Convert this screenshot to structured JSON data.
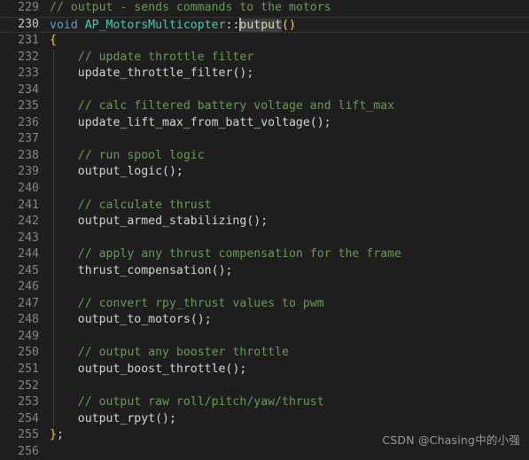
{
  "editor": {
    "theme": "dark-plus",
    "background_color": "#1e1e1e",
    "foreground_color": "#d4d4d4",
    "comment_color": "#6a9955",
    "keyword_color": "#569cd6",
    "type_color": "#4ec9b0",
    "function_color": "#dcdcaa",
    "bracket_color": "#ffd700",
    "gutter_color": "#858585",
    "current_line_number_color": "#c6c6c6",
    "current_line_border_color": "#333333",
    "indent_guide_color": "#404040",
    "word_highlight_color": "#3a3d41",
    "cursor_color": "#aeafad",
    "first_visible_line": 229,
    "last_visible_line": 256,
    "current_line": 230,
    "cursor_line": 230,
    "cursor_column": 31,
    "language": "cpp"
  },
  "watermark": {
    "text": "CSDN @Chasing中的小强"
  },
  "lines": [
    {
      "number": "229",
      "current": false,
      "indent_guide": false,
      "tokens": [
        {
          "t": "// output - sends commands to the motors",
          "c": "cmt"
        }
      ]
    },
    {
      "number": "230",
      "current": true,
      "indent_guide": false,
      "tokens": [
        {
          "t": "void",
          "c": "kw"
        },
        {
          "t": " ",
          "c": "id"
        },
        {
          "t": "AP_MotorsMulticopter",
          "c": "type"
        },
        {
          "t": "::",
          "c": "punc"
        },
        {
          "t": "CARET",
          "c": "caret"
        },
        {
          "t": "output",
          "c": "fn wordhl"
        },
        {
          "t": "(",
          "c": "br1"
        },
        {
          "t": ")",
          "c": "br1"
        }
      ]
    },
    {
      "number": "231",
      "current": false,
      "indent_guide": false,
      "tokens": [
        {
          "t": "{",
          "c": "br1"
        }
      ]
    },
    {
      "number": "232",
      "current": false,
      "indent_guide": true,
      "tokens": [
        {
          "t": "    ",
          "c": "id"
        },
        {
          "t": "// update throttle filter",
          "c": "cmt"
        }
      ]
    },
    {
      "number": "233",
      "current": false,
      "indent_guide": true,
      "tokens": [
        {
          "t": "    ",
          "c": "id"
        },
        {
          "t": "update_throttle_filter",
          "c": "id"
        },
        {
          "t": "();",
          "c": "punc"
        }
      ]
    },
    {
      "number": "234",
      "current": false,
      "indent_guide": true,
      "tokens": []
    },
    {
      "number": "235",
      "current": false,
      "indent_guide": true,
      "tokens": [
        {
          "t": "    ",
          "c": "id"
        },
        {
          "t": "// calc filtered battery voltage and lift_max",
          "c": "cmt"
        }
      ]
    },
    {
      "number": "236",
      "current": false,
      "indent_guide": true,
      "tokens": [
        {
          "t": "    ",
          "c": "id"
        },
        {
          "t": "update_lift_max_from_batt_voltage",
          "c": "id"
        },
        {
          "t": "();",
          "c": "punc"
        }
      ]
    },
    {
      "number": "237",
      "current": false,
      "indent_guide": true,
      "tokens": []
    },
    {
      "number": "238",
      "current": false,
      "indent_guide": true,
      "tokens": [
        {
          "t": "    ",
          "c": "id"
        },
        {
          "t": "// run spool logic",
          "c": "cmt"
        }
      ]
    },
    {
      "number": "239",
      "current": false,
      "indent_guide": true,
      "tokens": [
        {
          "t": "    ",
          "c": "id"
        },
        {
          "t": "output_logic",
          "c": "id"
        },
        {
          "t": "();",
          "c": "punc"
        }
      ]
    },
    {
      "number": "240",
      "current": false,
      "indent_guide": true,
      "tokens": []
    },
    {
      "number": "241",
      "current": false,
      "indent_guide": true,
      "tokens": [
        {
          "t": "    ",
          "c": "id"
        },
        {
          "t": "// calculate thrust",
          "c": "cmt"
        }
      ]
    },
    {
      "number": "242",
      "current": false,
      "indent_guide": true,
      "tokens": [
        {
          "t": "    ",
          "c": "id"
        },
        {
          "t": "output_armed_stabilizing",
          "c": "id"
        },
        {
          "t": "();",
          "c": "punc"
        }
      ]
    },
    {
      "number": "243",
      "current": false,
      "indent_guide": true,
      "tokens": []
    },
    {
      "number": "244",
      "current": false,
      "indent_guide": true,
      "tokens": [
        {
          "t": "    ",
          "c": "id"
        },
        {
          "t": "// apply any thrust compensation for the frame",
          "c": "cmt"
        }
      ]
    },
    {
      "number": "245",
      "current": false,
      "indent_guide": true,
      "tokens": [
        {
          "t": "    ",
          "c": "id"
        },
        {
          "t": "thrust_compensation",
          "c": "id"
        },
        {
          "t": "();",
          "c": "punc"
        }
      ]
    },
    {
      "number": "246",
      "current": false,
      "indent_guide": true,
      "tokens": []
    },
    {
      "number": "247",
      "current": false,
      "indent_guide": true,
      "tokens": [
        {
          "t": "    ",
          "c": "id"
        },
        {
          "t": "// convert rpy_thrust values to pwm",
          "c": "cmt"
        }
      ]
    },
    {
      "number": "248",
      "current": false,
      "indent_guide": true,
      "tokens": [
        {
          "t": "    ",
          "c": "id"
        },
        {
          "t": "output_to_motors",
          "c": "id"
        },
        {
          "t": "();",
          "c": "punc"
        }
      ]
    },
    {
      "number": "249",
      "current": false,
      "indent_guide": true,
      "tokens": []
    },
    {
      "number": "250",
      "current": false,
      "indent_guide": true,
      "tokens": [
        {
          "t": "    ",
          "c": "id"
        },
        {
          "t": "// output any booster throttle",
          "c": "cmt"
        }
      ]
    },
    {
      "number": "251",
      "current": false,
      "indent_guide": true,
      "tokens": [
        {
          "t": "    ",
          "c": "id"
        },
        {
          "t": "output_boost_throttle",
          "c": "id"
        },
        {
          "t": "();",
          "c": "punc"
        }
      ]
    },
    {
      "number": "252",
      "current": false,
      "indent_guide": true,
      "tokens": []
    },
    {
      "number": "253",
      "current": false,
      "indent_guide": true,
      "tokens": [
        {
          "t": "    ",
          "c": "id"
        },
        {
          "t": "// output raw roll/pitch/yaw/thrust",
          "c": "cmt"
        }
      ]
    },
    {
      "number": "254",
      "current": false,
      "indent_guide": true,
      "tokens": [
        {
          "t": "    ",
          "c": "id"
        },
        {
          "t": "output_rpyt",
          "c": "id"
        },
        {
          "t": "();",
          "c": "punc"
        }
      ]
    },
    {
      "number": "255",
      "current": false,
      "indent_guide": false,
      "tokens": [
        {
          "t": "}",
          "c": "br1"
        },
        {
          "t": ";",
          "c": "punc"
        }
      ]
    },
    {
      "number": "256",
      "current": false,
      "indent_guide": false,
      "tokens": []
    }
  ]
}
